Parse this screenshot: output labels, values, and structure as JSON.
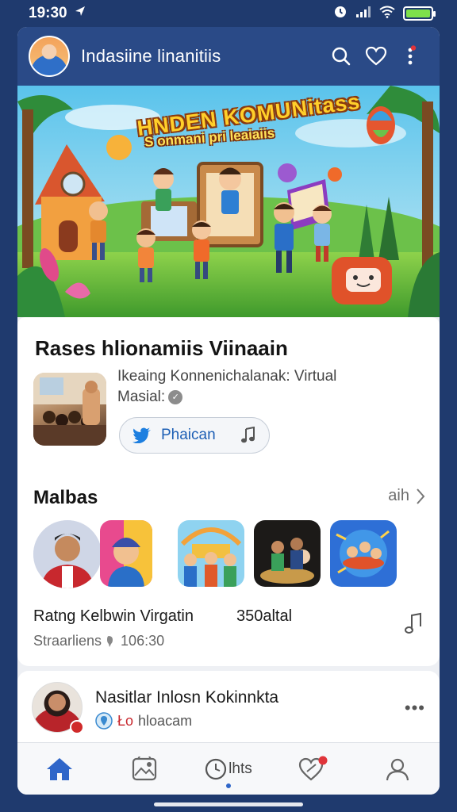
{
  "status_bar": {
    "time": "19:30"
  },
  "header": {
    "title": "Indasiine linanitiis"
  },
  "banner": {
    "title": "HNDEN KOMUNitass",
    "subtitle": "S  onmani  pri leaiaiis"
  },
  "featured": {
    "section_title": "Rases hlionamiis Viinaain",
    "description_line1": "Ikeaing Konnenichalanak: Virtual",
    "description_line2": "Masial:",
    "button_label": "Phaican"
  },
  "list_section": {
    "title": "Malbas",
    "see_all": "aih",
    "row_title": "Ratng Kelbwin Virgatin",
    "row_count": "350altal",
    "row_meta_a": "Straarliens",
    "row_meta_b": "106:30"
  },
  "post": {
    "title": "Nasitlar Inlosn Kokinnkta",
    "sub_a": "Ło",
    "sub_b": "hloacam"
  },
  "nav": {
    "center_label": "lhts"
  },
  "colors": {
    "header_bg": "#2a4a87",
    "accent_blue": "#1d5fb5",
    "battery_green": "#7ee04a",
    "notify_red": "#d02a2a"
  }
}
